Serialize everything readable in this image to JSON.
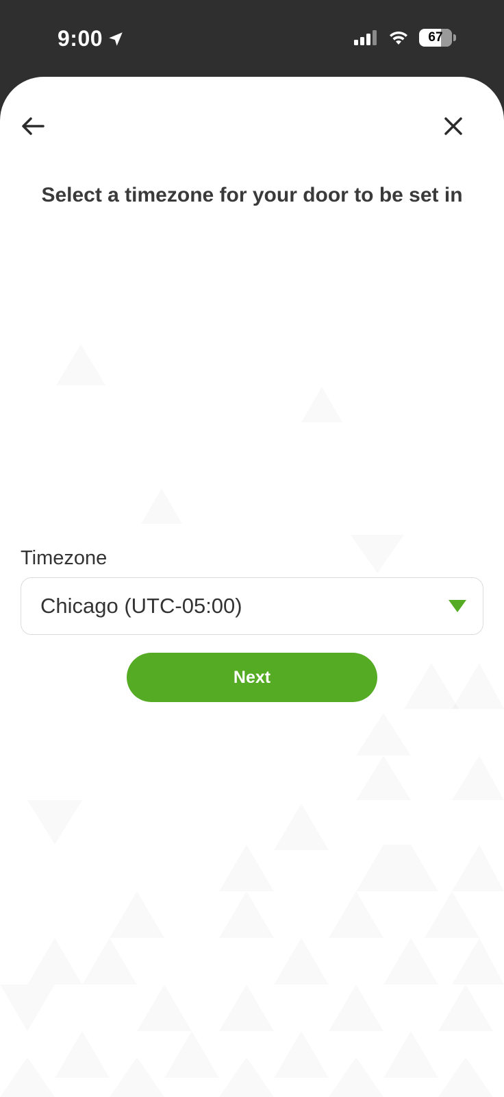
{
  "status_bar": {
    "time": "9:00",
    "battery": "67",
    "location_icon": "location-arrow-icon",
    "signal_icon": "cellular-signal-icon",
    "wifi_icon": "wifi-icon"
  },
  "header": {
    "back_icon": "back-arrow-icon",
    "close_icon": "close-icon"
  },
  "main": {
    "title": "Select a timezone for your door to be set in",
    "timezone_label": "Timezone",
    "timezone_value": "Chicago (UTC-05:00)",
    "next_label": "Next"
  },
  "colors": {
    "accent": "#56ab24",
    "status_bar": "#2f2f2f"
  }
}
